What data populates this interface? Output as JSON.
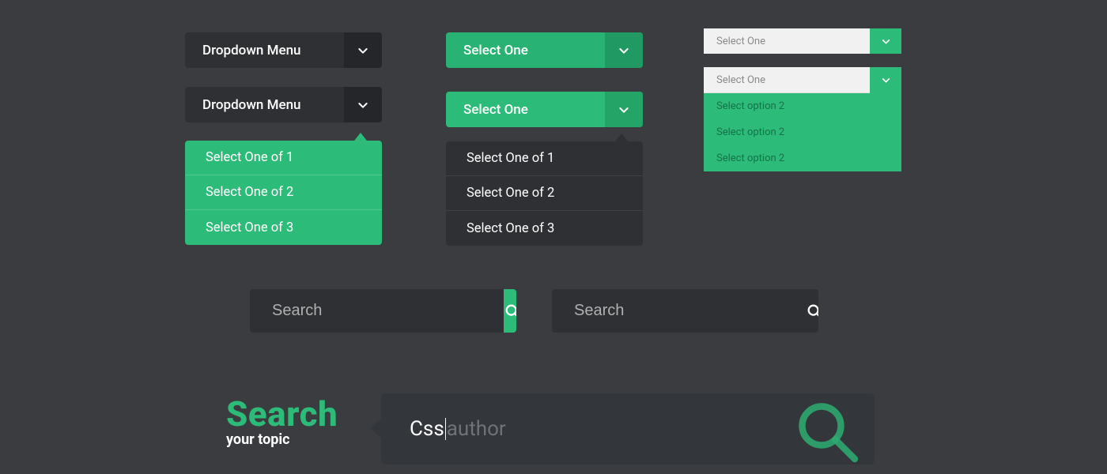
{
  "colors": {
    "green": "#2cbb78",
    "greenDark": "#209a62",
    "dark": "#2e3033",
    "bg": "#3a3c3f"
  },
  "col1": {
    "closed_label": "Dropdown Menu",
    "open_label": "Dropdown Menu",
    "options": [
      "Select One of 1",
      "Select One of 2",
      "Select One of 3"
    ]
  },
  "col2": {
    "closed_label": "Select One",
    "open_label": "Select One",
    "options": [
      "Select One of 1",
      "Select One of 2",
      "Select One of 3"
    ]
  },
  "col3": {
    "closed_label": "Select One",
    "open_selected": "Select One",
    "options": [
      "Select  option 2",
      "Select  option 2",
      "Select  option 2"
    ]
  },
  "search_row": {
    "placeholder1": "Search",
    "placeholder2": "Search"
  },
  "big": {
    "title": "Search",
    "subtitle": "your topic",
    "typed": "Css",
    "ghost": "author"
  }
}
